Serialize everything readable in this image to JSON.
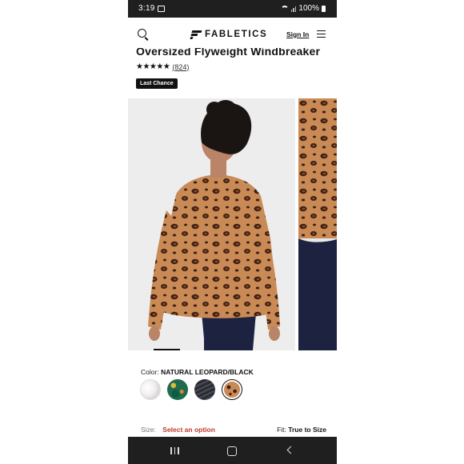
{
  "status_bar": {
    "time": "3:19",
    "battery": "100%"
  },
  "header": {
    "brand": "FABLETICS",
    "sign_in": "Sign In"
  },
  "product": {
    "title": "Oversized Flyweight Windbreaker",
    "stars": "★★★★★",
    "rating_stars": 4.5,
    "review_count": "(824)",
    "badge": "Last Chance"
  },
  "gallery": {
    "image_count": 2,
    "current_index": 1
  },
  "color": {
    "label": "Color:",
    "selected": "NATURAL LEOPARD/BLACK",
    "swatches": [
      {
        "name": "white-marble",
        "selected": false
      },
      {
        "name": "green-floral",
        "selected": false
      },
      {
        "name": "black-stripe",
        "selected": false
      },
      {
        "name": "natural-leopard-black",
        "selected": true
      }
    ]
  },
  "size": {
    "label": "Size:",
    "placeholder": "Select an option"
  },
  "fit": {
    "label": "Fit:",
    "value": "True to Size"
  },
  "colors": {
    "accent_red": "#c0392b",
    "leopard_base": "#c98a55",
    "leopard_spot": "#3a1f14",
    "pants": "#1d2240"
  }
}
